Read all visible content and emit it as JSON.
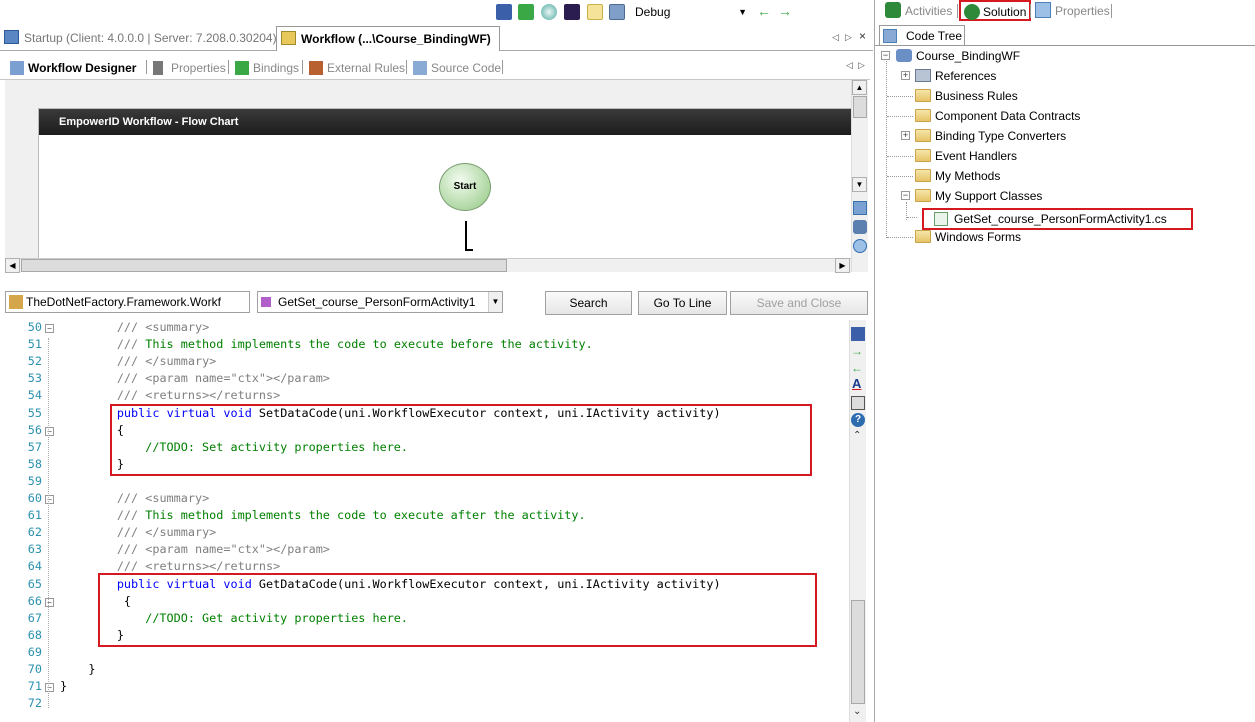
{
  "toolbar": {
    "config_select": "Debug",
    "icons": [
      "save-icon",
      "check-icon",
      "run-icon",
      "visual-studio-icon",
      "new-item-icon",
      "windows-icon",
      "back-arrow-icon",
      "forward-arrow-icon"
    ]
  },
  "document_tabs": [
    {
      "label": "Startup (Client: 4.0.0.0 | Server: 7.208.0.30204)",
      "active": false
    },
    {
      "label": "Workflow (...\\Course_BindingWF)",
      "active": true
    }
  ],
  "designer_tabs": [
    "Workflow Designer",
    "Properties",
    "Bindings",
    "External Rules",
    "Source Code"
  ],
  "flowchart": {
    "title": "EmpowerID Workflow - Flow Chart",
    "start_label": "Start"
  },
  "code_toolbar": {
    "class_combo": "TheDotNetFactory.Framework.Workf",
    "member_combo": "GetSet_course_PersonFormActivity1",
    "search_button": "Search",
    "goto_button": "Go To Line",
    "save_close_button": "Save and Close"
  },
  "code_lines": [
    {
      "n": "50",
      "fold": "-",
      "t": "        /// <summary>",
      "kind": "doc"
    },
    {
      "n": "51",
      "fold": "",
      "t": "        /// This method implements the code to execute before the activity.",
      "kind": "doc"
    },
    {
      "n": "52",
      "fold": "",
      "t": "        /// </summary>",
      "kind": "doc"
    },
    {
      "n": "53",
      "fold": "",
      "t": "        /// <param name=\"ctx\"></param>",
      "kind": "doc"
    },
    {
      "n": "54",
      "fold": "",
      "t": "        /// <returns></returns>",
      "kind": "doc"
    },
    {
      "n": "55",
      "fold": "",
      "t": "        public virtual void SetDataCode(uni.WorkflowExecutor context, uni.IActivity activity)",
      "kind": "sig"
    },
    {
      "n": "56",
      "fold": "-",
      "t": "        {",
      "kind": "plain"
    },
    {
      "n": "57",
      "fold": "",
      "t": "            //TODO: Set activity properties here.",
      "kind": "comment"
    },
    {
      "n": "58",
      "fold": "",
      "t": "        }",
      "kind": "plain"
    },
    {
      "n": "59",
      "fold": "",
      "t": "",
      "kind": "plain"
    },
    {
      "n": "60",
      "fold": "-",
      "t": "        /// <summary>",
      "kind": "doc"
    },
    {
      "n": "61",
      "fold": "",
      "t": "        /// This method implements the code to execute after the activity.",
      "kind": "doc"
    },
    {
      "n": "62",
      "fold": "",
      "t": "        /// </summary>",
      "kind": "doc"
    },
    {
      "n": "63",
      "fold": "",
      "t": "        /// <param name=\"ctx\"></param>",
      "kind": "doc"
    },
    {
      "n": "64",
      "fold": "",
      "t": "        /// <returns></returns>",
      "kind": "doc"
    },
    {
      "n": "65",
      "fold": "",
      "t": "        public virtual void GetDataCode(uni.WorkflowExecutor context, uni.IActivity activity)",
      "kind": "sig"
    },
    {
      "n": "66",
      "fold": "-",
      "t": "         {",
      "kind": "plain"
    },
    {
      "n": "67",
      "fold": "",
      "t": "            //TODO: Get activity properties here.",
      "kind": "comment"
    },
    {
      "n": "68",
      "fold": "",
      "t": "        }",
      "kind": "plain"
    },
    {
      "n": "69",
      "fold": "",
      "t": "",
      "kind": "plain"
    },
    {
      "n": "70",
      "fold": "",
      "t": "    }",
      "kind": "plain"
    },
    {
      "n": "71",
      "fold": "-",
      "t": "}",
      "kind": "plain"
    },
    {
      "n": "72",
      "fold": "",
      "t": "",
      "kind": "plain"
    }
  ],
  "right_panel": {
    "tabs": [
      {
        "label": "Activities",
        "active": false
      },
      {
        "label": "Solution",
        "active": true
      },
      {
        "label": "Properties",
        "active": false
      }
    ],
    "subtab": "Code Tree",
    "tree": {
      "root": "Course_BindingWF",
      "items": [
        {
          "label": "References",
          "expander": "+",
          "icon": "references-icon"
        },
        {
          "label": "Business Rules",
          "expander": "",
          "icon": "folder-icon"
        },
        {
          "label": "Component Data Contracts",
          "expander": "",
          "icon": "folder-icon"
        },
        {
          "label": "Binding Type Converters",
          "expander": "+",
          "icon": "folder-icon"
        },
        {
          "label": "Event Handlers",
          "expander": "",
          "icon": "folder-icon"
        },
        {
          "label": "My Methods",
          "expander": "",
          "icon": "folder-icon"
        },
        {
          "label": "My Support Classes",
          "expander": "-",
          "icon": "folder-icon"
        },
        {
          "label": "Windows Forms",
          "expander": "",
          "icon": "folder-icon"
        }
      ],
      "child_file": "GetSet_course_PersonFormActivity1.cs"
    }
  },
  "colors": {
    "highlight_box": "#d41920",
    "keyword": "#0000ff",
    "comment": "#008000",
    "line_number": "#2b91af"
  }
}
